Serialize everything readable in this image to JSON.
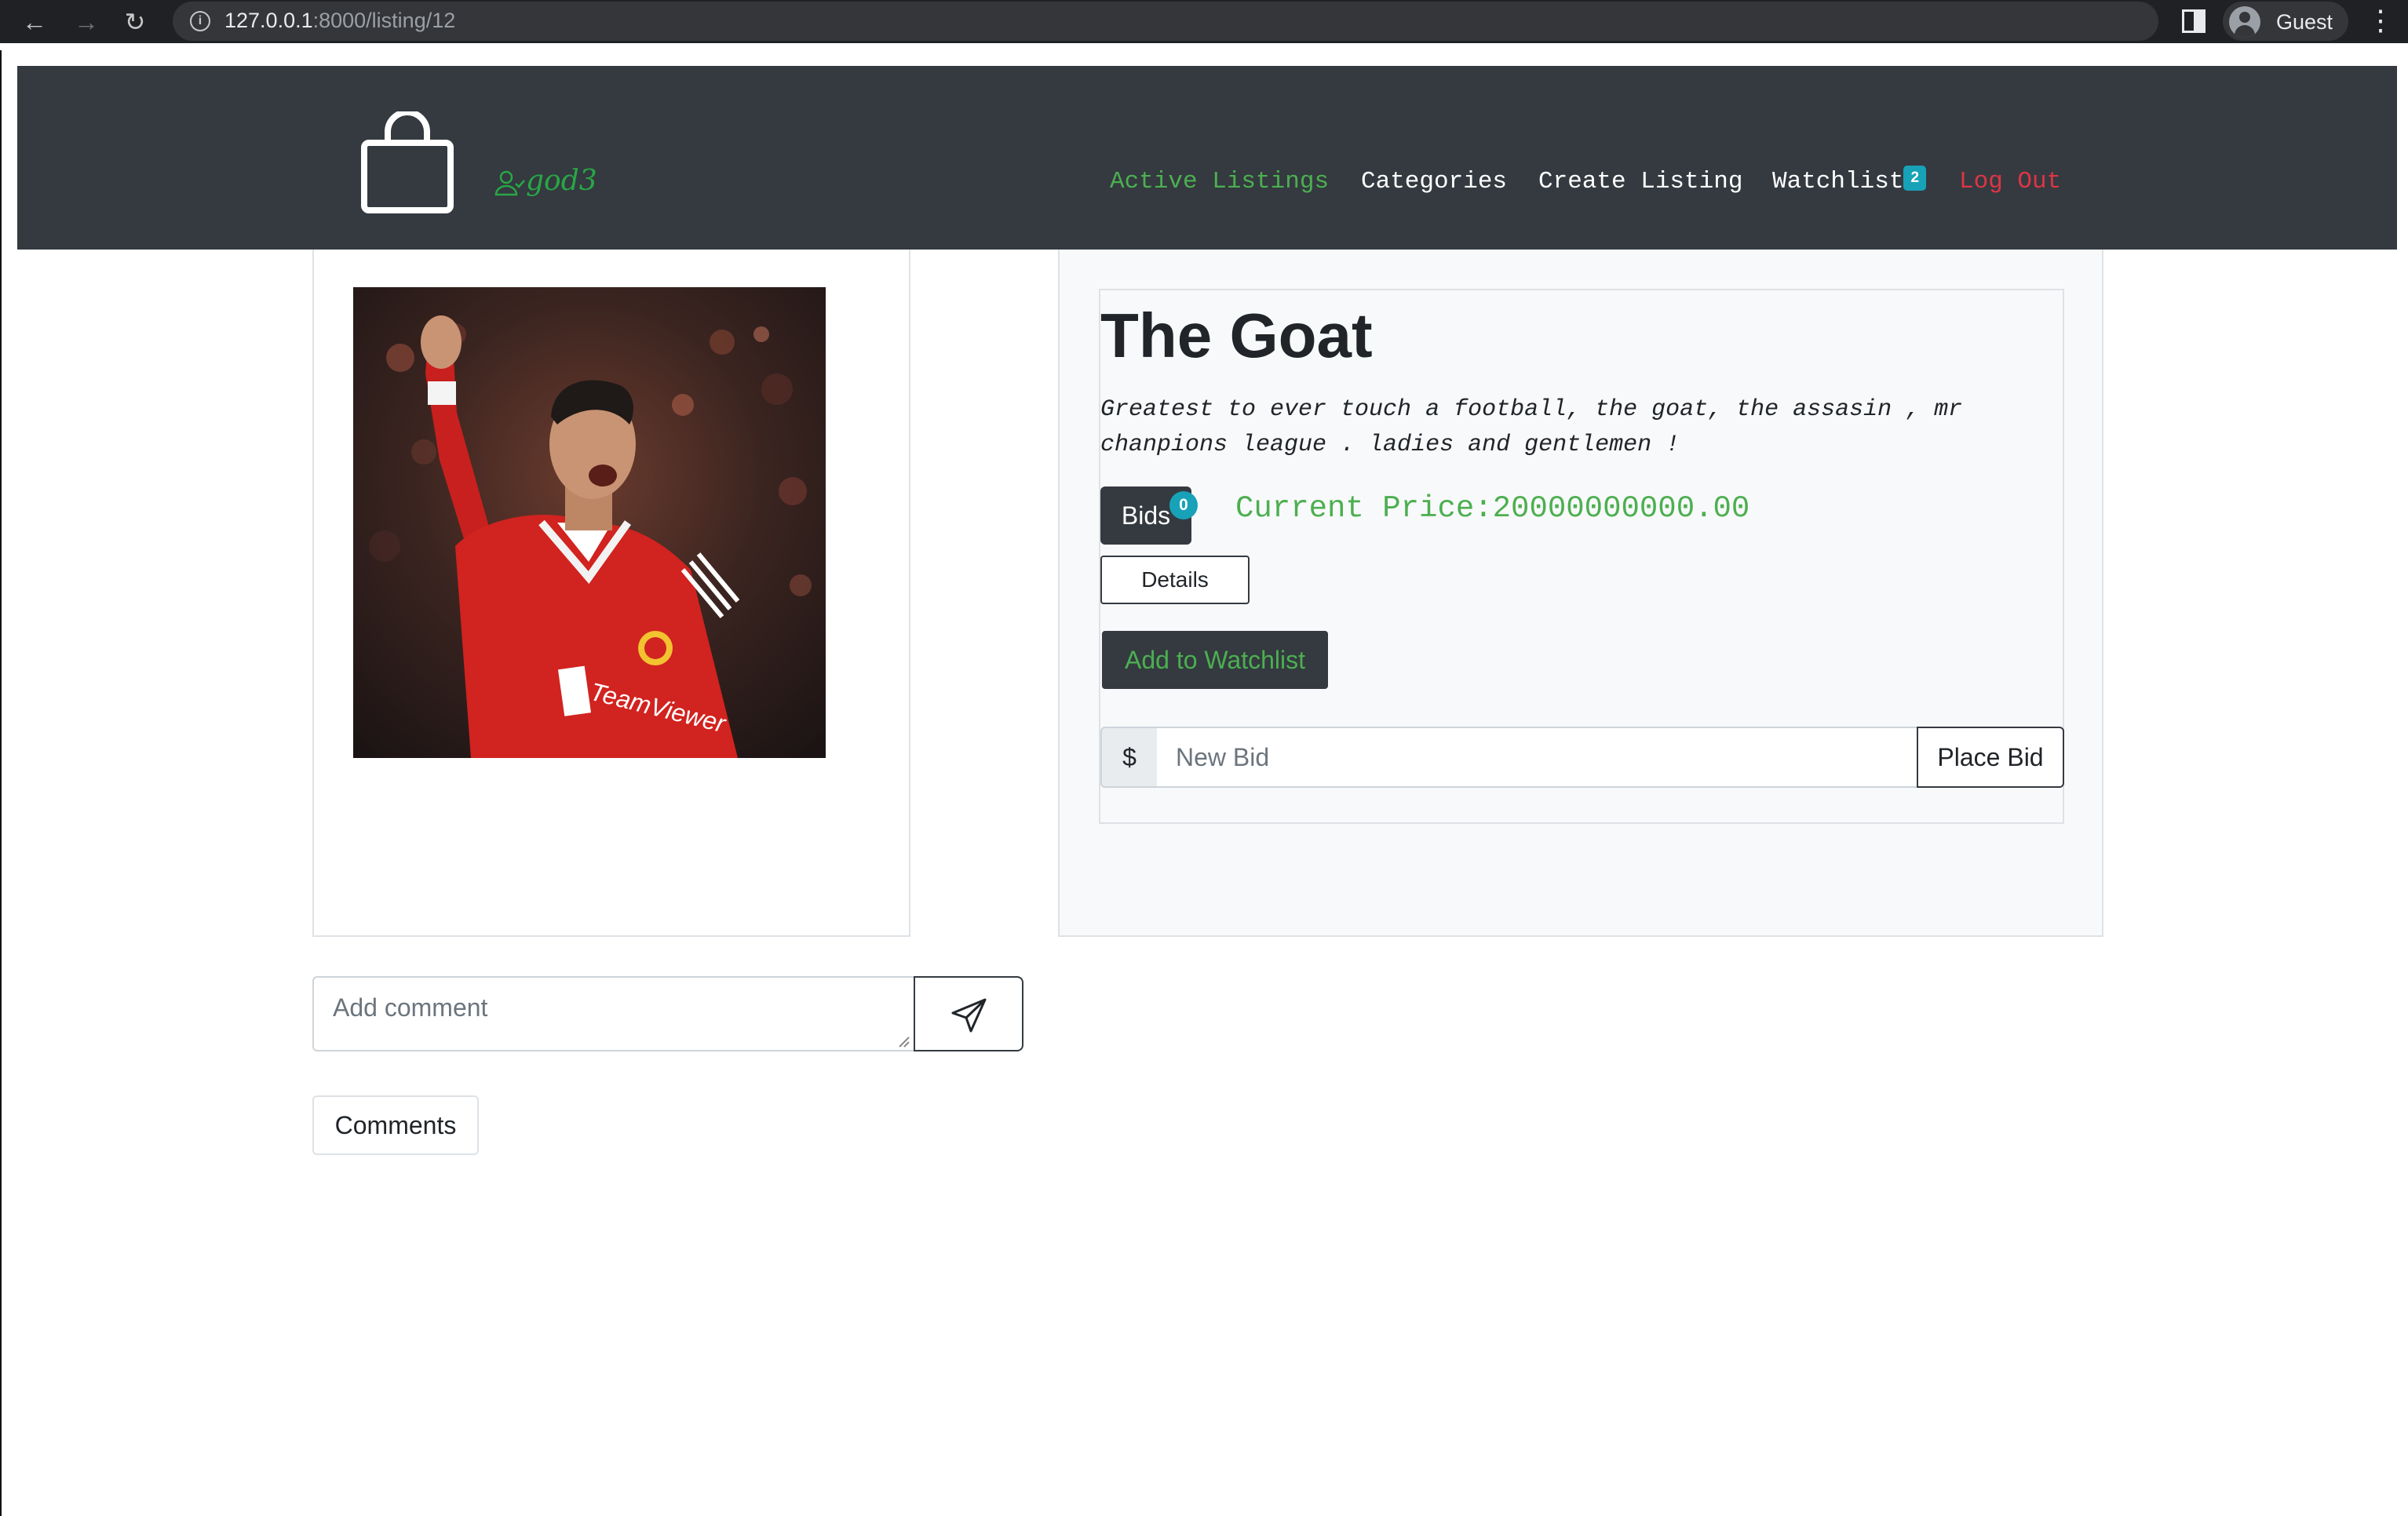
{
  "browser": {
    "url_host": "127.0.0.1",
    "url_path": ":8000/listing/12",
    "profile_label": "Guest"
  },
  "navbar": {
    "username": "god3",
    "links": [
      {
        "label": "Active Listings"
      },
      {
        "label": "Categories"
      },
      {
        "label": "Create Listing"
      },
      {
        "label": "Watchlist",
        "badge": "2"
      },
      {
        "label": "Log Out"
      }
    ]
  },
  "listing": {
    "title": "The Goat",
    "description_line1": "Greatest to ever touch a football, the goat, the assasin , mr",
    "description_line2": "chanpions league . ladies and gentlemen !",
    "bids_label": "Bids",
    "bids_count": "0",
    "current_price": "Current Price:20000000000.00",
    "details_label": "Details",
    "watchlist_label": "Add to Watchlist",
    "bid_prefix": "$",
    "bid_placeholder": "New Bid",
    "place_bid_label": "Place Bid"
  },
  "comments": {
    "placeholder": "Add comment",
    "comments_button": "Comments"
  },
  "colors": {
    "navbar_bg": "#343a40",
    "accent_green": "#4caf50",
    "logout_red": "#dc3545",
    "badge_info": "#17a2b8"
  },
  "icons": {
    "back": "arrow-left-icon",
    "forward": "arrow-right-icon",
    "reload": "reload-icon",
    "site_info": "info-icon",
    "logo": "shopping-bag-icon",
    "user": "user-check-icon",
    "send": "send-icon"
  }
}
